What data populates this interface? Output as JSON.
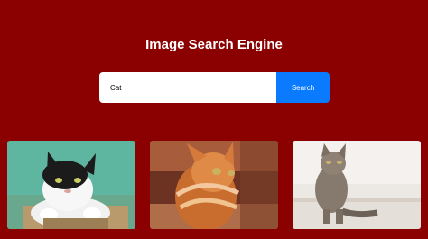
{
  "header": {
    "title": "Image Search Engine"
  },
  "search": {
    "value": "Cat",
    "placeholder": "",
    "button_label": "Search"
  },
  "results": [
    {
      "subject": "black-and-white cat on green background"
    },
    {
      "subject": "orange tabby cat looking up"
    },
    {
      "subject": "tabby cat sitting on stairs"
    }
  ],
  "colors": {
    "background": "#8b0000",
    "accent": "#0a7bff",
    "title_text": "#ffffff"
  }
}
